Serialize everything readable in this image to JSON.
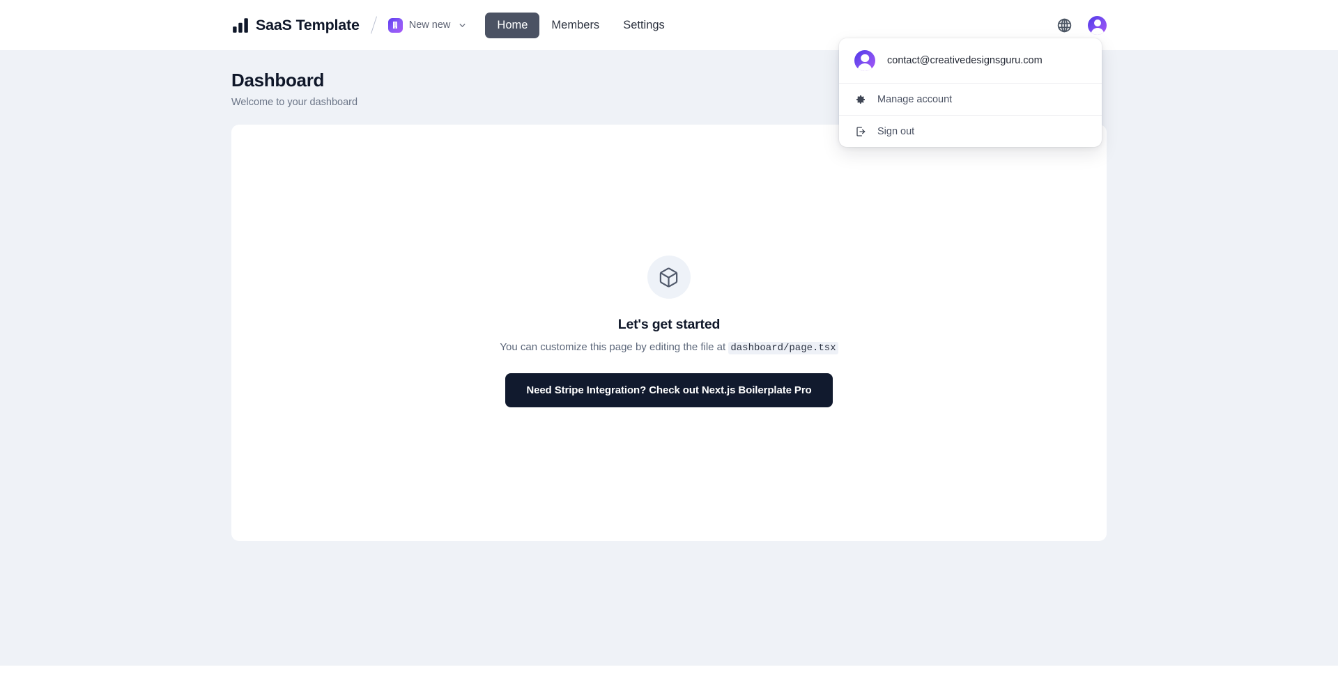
{
  "header": {
    "brand_name": "SaaS Template",
    "brand_logo_icon": "bar-chart-icon",
    "divider": "/",
    "org_switcher": {
      "name": "New new",
      "avatar_icon": "building-icon",
      "caret_icon": "chevron-down-icon"
    },
    "nav": [
      {
        "label": "Home",
        "active": true
      },
      {
        "label": "Members",
        "active": false
      },
      {
        "label": "Settings",
        "active": false
      }
    ],
    "locale_button_icon": "globe-icon",
    "avatar_icon": "user-avatar-icon"
  },
  "user_menu": {
    "email": "contact@creativedesignsguru.com",
    "avatar_icon": "user-avatar-icon",
    "items": [
      {
        "label": "Manage account",
        "icon": "gear-icon"
      },
      {
        "label": "Sign out",
        "icon": "sign-out-icon"
      }
    ]
  },
  "page": {
    "title": "Dashboard",
    "subtitle": "Welcome to your dashboard"
  },
  "empty_state": {
    "icon": "box-3d-icon",
    "title": "Let's get started",
    "description_prefix": "You can customize this page by editing the file at ",
    "description_code": "dashboard/page.tsx",
    "cta_label": "Need Stripe Integration? Check out Next.js Boilerplate Pro"
  },
  "colors": {
    "page_background": "#eff2f7",
    "header_background": "#ffffff",
    "card_background": "#ffffff",
    "nav_active_background": "#4b5263",
    "cta_background": "#111a2e",
    "brand_purple": "#7c4ef0",
    "text_primary": "#0f1729",
    "text_muted": "#6b7587"
  }
}
